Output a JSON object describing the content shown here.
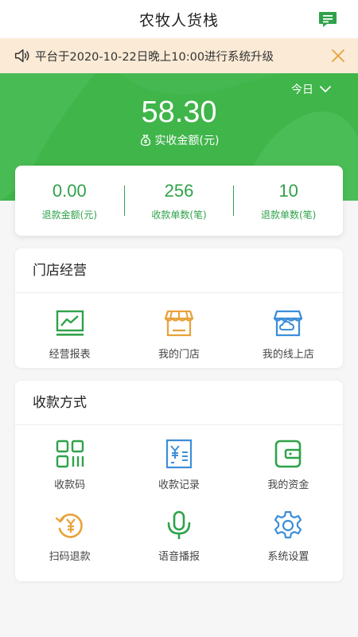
{
  "header": {
    "title": "农牧人货栈",
    "message_icon": "message-icon"
  },
  "notice": {
    "text": "平台于2020-10-22日晚上10:00进行系统升级",
    "icon": "speaker-icon",
    "close_icon": "close-icon"
  },
  "hero": {
    "period": "今日",
    "amount": "58.30",
    "amount_label": "实收金额(元)",
    "color": "#3fb54a"
  },
  "stats": [
    {
      "value": "0.00",
      "label": "退款金额(元)"
    },
    {
      "value": "256",
      "label": "收款单数(笔)"
    },
    {
      "value": "10",
      "label": "退款单数(笔)"
    }
  ],
  "store_section": {
    "title": "门店经营",
    "items": [
      {
        "label": "经营报表",
        "icon": "report-chart-icon"
      },
      {
        "label": "我的门店",
        "icon": "store-icon"
      },
      {
        "label": "我的线上店",
        "icon": "online-store-icon"
      }
    ]
  },
  "pay_section": {
    "title": "收款方式",
    "items": [
      {
        "label": "收款码",
        "icon": "qr-code-icon"
      },
      {
        "label": "收款记录",
        "icon": "receipt-record-icon"
      },
      {
        "label": "我的资金",
        "icon": "wallet-icon"
      },
      {
        "label": "扫码退款",
        "icon": "refund-icon"
      },
      {
        "label": "语音播报",
        "icon": "microphone-icon"
      },
      {
        "label": "系统设置",
        "icon": "settings-icon"
      }
    ]
  },
  "colors": {
    "green": "#3fb54a",
    "dark_green": "#2fa24a",
    "orange": "#e8a23a",
    "blue": "#3d8ed8",
    "notice_bg": "#fbebd6"
  }
}
